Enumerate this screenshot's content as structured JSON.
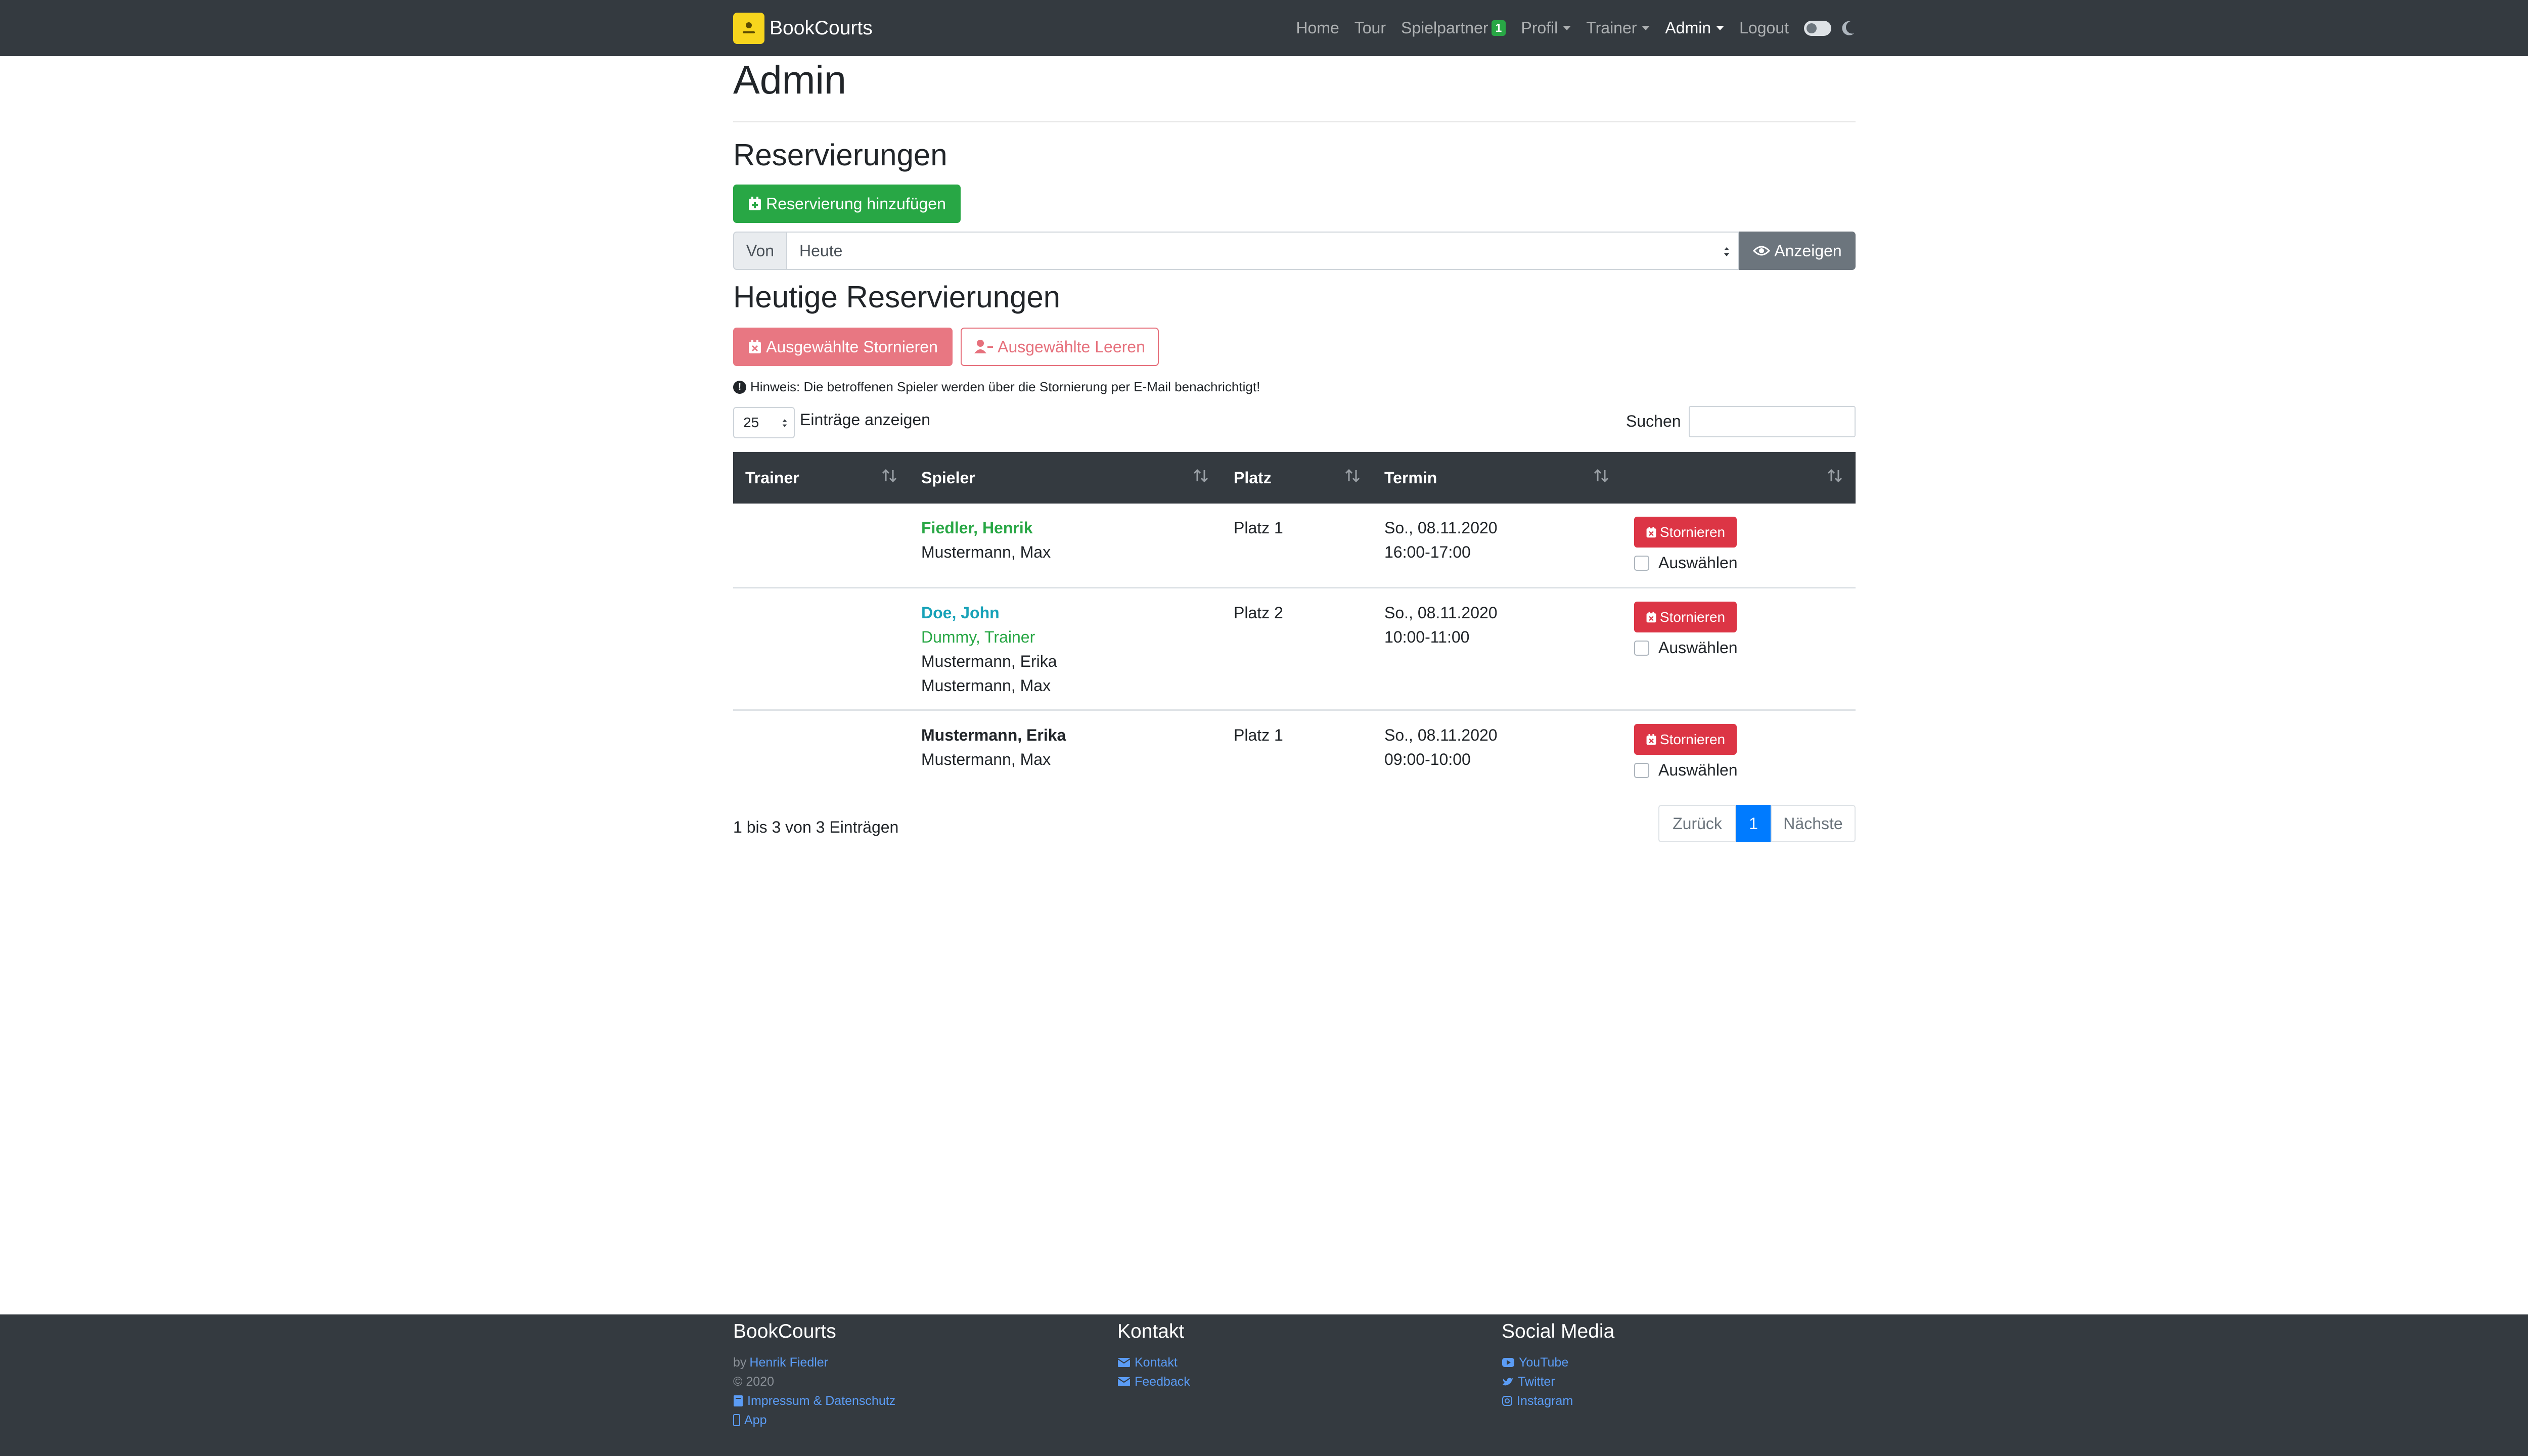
{
  "nav": {
    "brand": "BookCourts",
    "items": [
      {
        "label": "Home"
      },
      {
        "label": "Tour"
      },
      {
        "label": "Spielpartner",
        "badge": "1"
      },
      {
        "label": "Profil"
      },
      {
        "label": "Trainer"
      },
      {
        "label": "Admin"
      },
      {
        "label": "Logout"
      }
    ]
  },
  "page": {
    "title": "Admin"
  },
  "reservations": {
    "heading": "Reservierungen",
    "add_button": "Reservierung hinzufügen",
    "from_label": "Von",
    "from_value": "Heute",
    "show_button": "Anzeigen"
  },
  "today": {
    "heading": "Heutige Reservierungen",
    "cancel_selected": "Ausgewählte Stornieren",
    "clear_selected": "Ausgewählte Leeren",
    "hint": "Hinweis: Die betroffenen Spieler werden über die Stornierung per E-Mail benachrichtigt!"
  },
  "table": {
    "length_value": "25",
    "length_label": "Einträge anzeigen",
    "search_label": "Suchen",
    "headers": {
      "trainer": "Trainer",
      "spieler": "Spieler",
      "platz": "Platz",
      "termin": "Termin"
    },
    "rows": [
      {
        "players": [
          "Fiedler, Henrik",
          "Mustermann, Max"
        ],
        "platz": "Platz 1",
        "date": "So., 08.11.2020",
        "time": "16:00-17:00",
        "action": "Stornieren",
        "select": "Auswählen"
      },
      {
        "players": [
          "Doe, John",
          "Dummy, Trainer",
          "Mustermann, Erika",
          "Mustermann, Max"
        ],
        "platz": "Platz 2",
        "date": "So., 08.11.2020",
        "time": "10:00-11:00",
        "action": "Stornieren",
        "select": "Auswählen"
      },
      {
        "players": [
          "Mustermann, Erika",
          "Mustermann, Max"
        ],
        "platz": "Platz 1",
        "date": "So., 08.11.2020",
        "time": "09:00-10:00",
        "action": "Stornieren",
        "select": "Auswählen"
      }
    ],
    "info": "1 bis 3 von 3 Einträgen",
    "pager": {
      "prev": "Zurück",
      "current": "1",
      "next": "Nächste"
    }
  },
  "footer": {
    "col1": {
      "title": "BookCourts",
      "by": "by",
      "author": "Henrik Fiedler",
      "copyright": "© 2020",
      "imprint": "Impressum & Datenschutz",
      "app": "App"
    },
    "col2": {
      "title": "Kontakt",
      "contact": "Kontakt",
      "feedback": "Feedback"
    },
    "col3": {
      "title": "Social Media",
      "youtube": "YouTube",
      "twitter": "Twitter",
      "instagram": "Instagram"
    }
  },
  "colors": {
    "navbar": "#343a40",
    "success": "#28a745",
    "danger": "#dc3545",
    "primary": "#007bff",
    "secondary": "#6c757d",
    "info": "#17a2b8"
  },
  "icons": [
    "calendar-plus-icon",
    "eye-icon",
    "calendar-x-icon",
    "user-minus-icon",
    "info-circle-icon",
    "sort-icon",
    "moon-icon",
    "envelope-icon",
    "youtube-icon",
    "twitter-icon",
    "instagram-icon",
    "mobile-icon",
    "book-icon"
  ]
}
